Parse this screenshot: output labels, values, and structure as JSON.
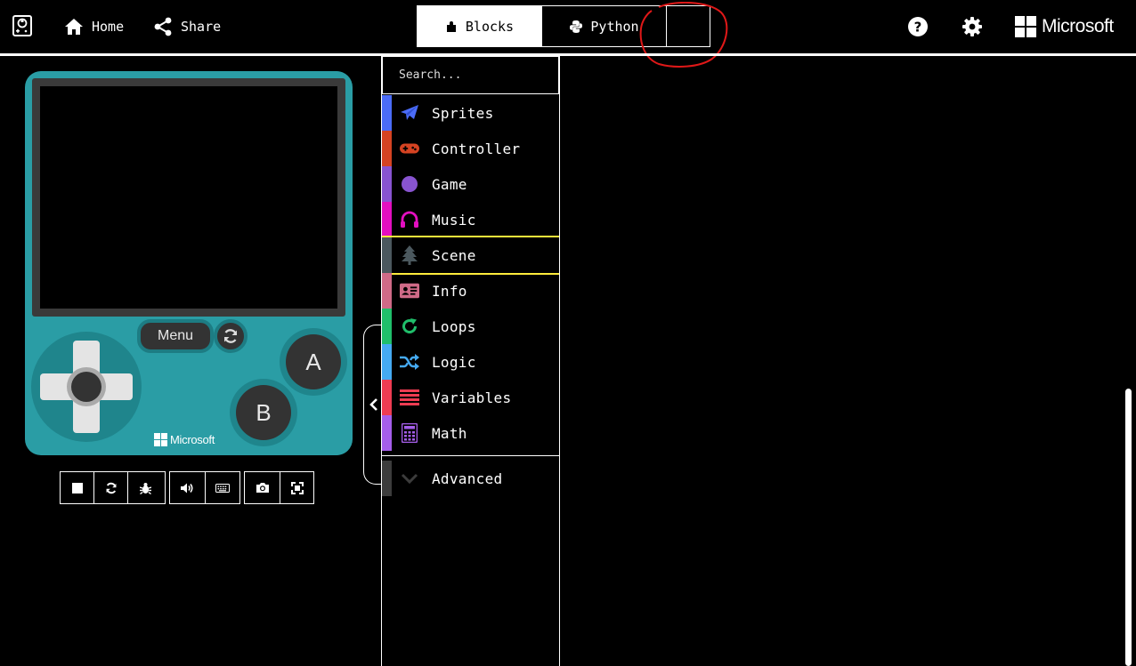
{
  "header": {
    "home_label": "Home",
    "share_label": "Share",
    "editor_toggle": {
      "blocks_label": "Blocks",
      "python_label": "Python",
      "selected": "Blocks"
    },
    "brand_text": "Microsoft"
  },
  "simulator": {
    "menu_label": "Menu",
    "a_label": "A",
    "b_label": "B",
    "brand_text": "Microsoft",
    "toolbar": [
      "stop-icon",
      "restart-icon",
      "debug-icon",
      "sound-icon",
      "keyboard-icon",
      "screenshot-icon",
      "fullscreen-icon"
    ]
  },
  "toolbox": {
    "search_placeholder": "Search...",
    "categories": [
      {
        "label": "Sprites",
        "color": "#4b6cf7",
        "icon": "paper-plane-icon"
      },
      {
        "label": "Controller",
        "color": "#d54322",
        "icon": "gamepad-icon"
      },
      {
        "label": "Game",
        "color": "#8854d0",
        "icon": "circle-icon"
      },
      {
        "label": "Music",
        "color": "#e30fc0",
        "icon": "headphones-icon"
      },
      {
        "label": "Scene",
        "color": "#4b585e",
        "icon": "tree-icon"
      },
      {
        "label": "Info",
        "color": "#cf6a87",
        "icon": "id-card-icon"
      },
      {
        "label": "Loops",
        "color": "#20bf6b",
        "icon": "refresh-icon"
      },
      {
        "label": "Logic",
        "color": "#45aaf2",
        "icon": "shuffle-icon"
      },
      {
        "label": "Variables",
        "color": "#ee3c52",
        "icon": "list-icon"
      },
      {
        "label": "Math",
        "color": "#a55eea",
        "icon": "calculator-icon"
      }
    ],
    "selected_category": "Scene",
    "advanced_label": "Advanced",
    "advanced_color": "#3c3c3c"
  },
  "annotation": {
    "color": "#e01818"
  }
}
